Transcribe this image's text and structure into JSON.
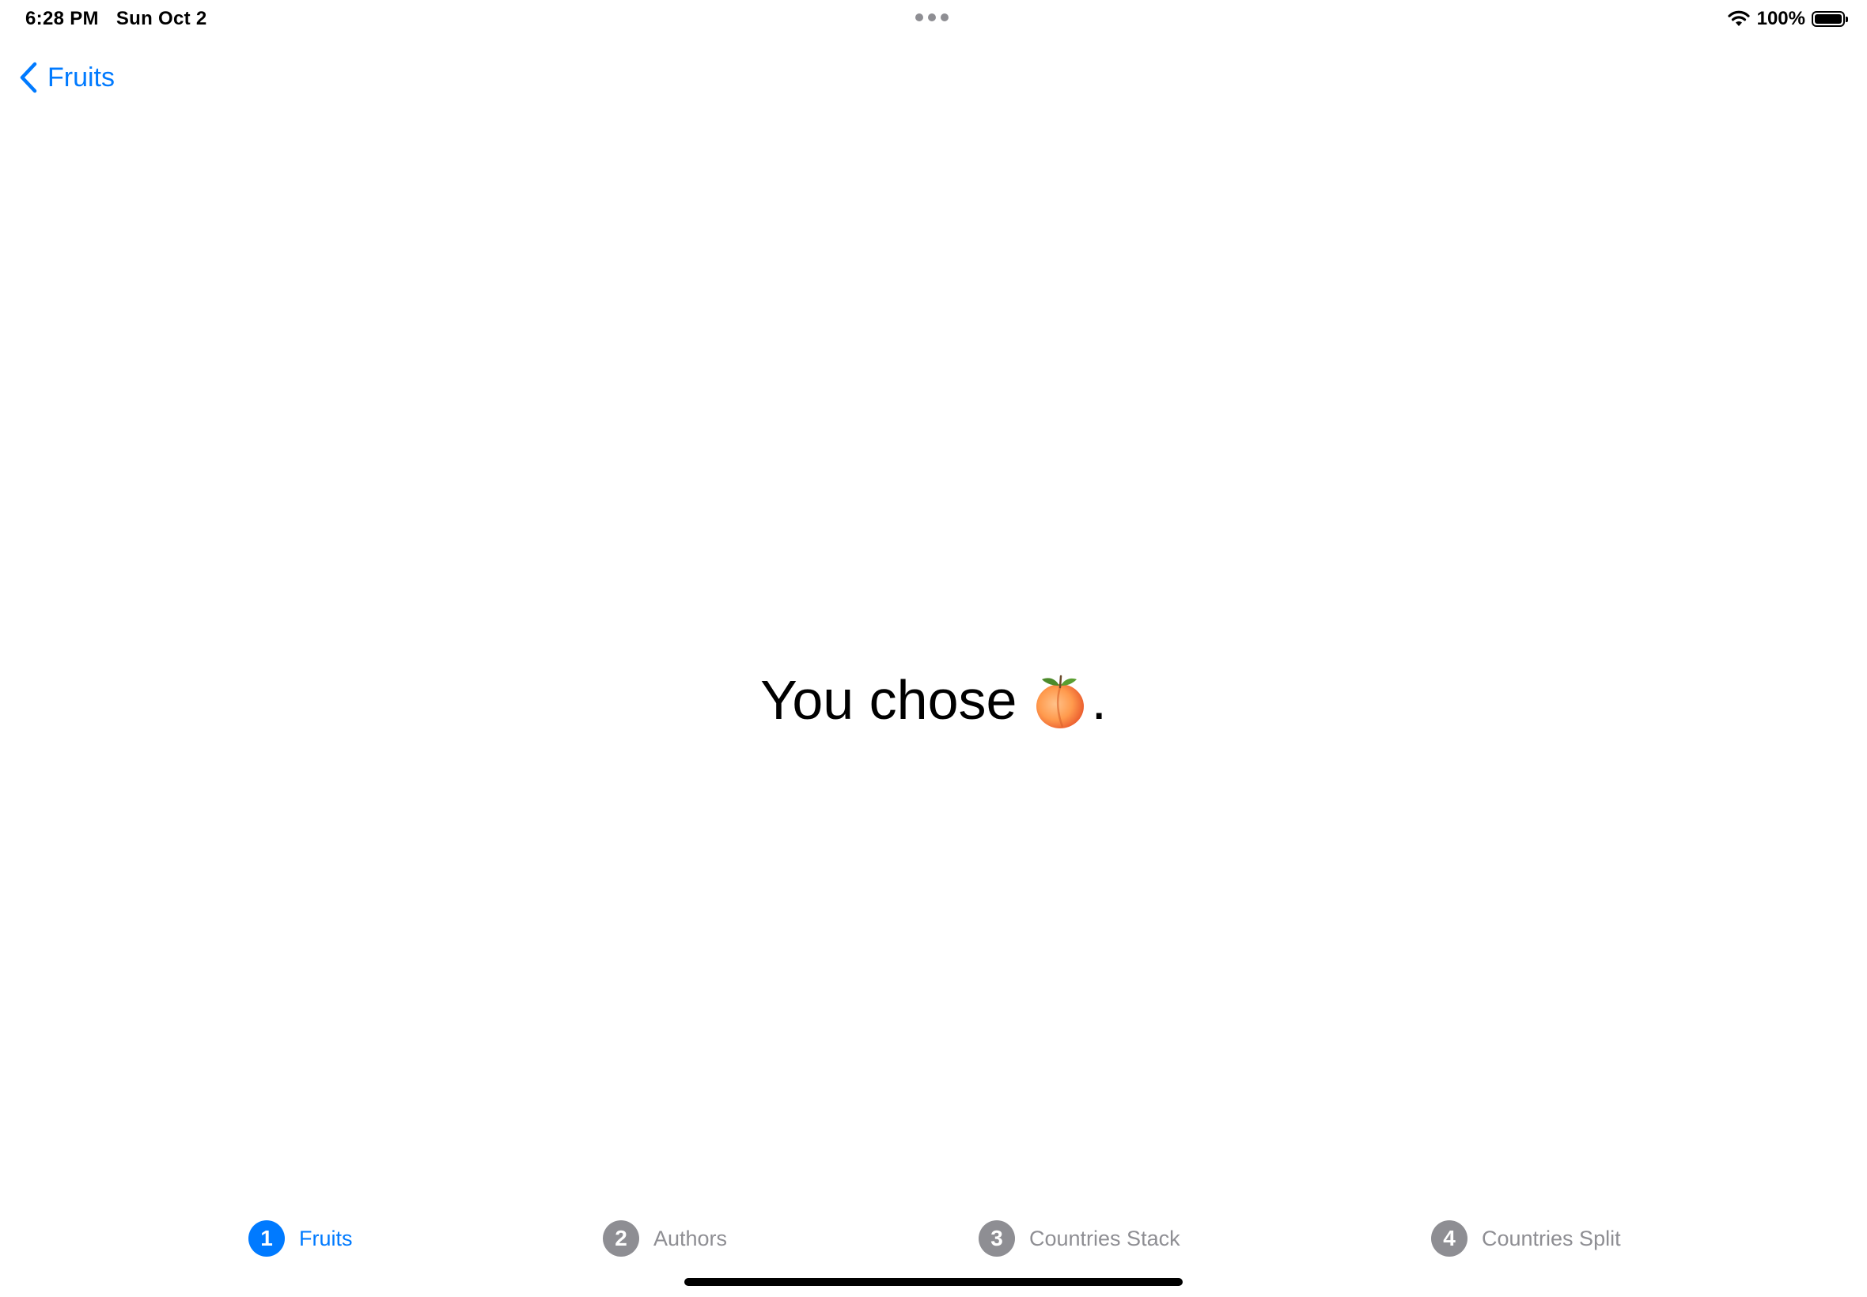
{
  "status_bar": {
    "time": "6:28 PM",
    "date": "Sun Oct 2",
    "battery_percent": "100%",
    "battery_level": 1.0,
    "icons": [
      "wifi-icon",
      "battery-icon",
      "multitask-dots-icon"
    ]
  },
  "nav": {
    "back_label": "Fruits",
    "back_icon": "chevron-left-icon"
  },
  "main": {
    "message_prefix": "You chose",
    "message_suffix": ".",
    "fruit_icon": "peach-emoji"
  },
  "tabs": [
    {
      "number": "1",
      "label": "Fruits",
      "active": true
    },
    {
      "number": "2",
      "label": "Authors",
      "active": false
    },
    {
      "number": "3",
      "label": "Countries Stack",
      "active": false
    },
    {
      "number": "4",
      "label": "Countries Split",
      "active": false
    }
  ],
  "colors": {
    "accent": "#007aff",
    "inactive": "#8e8e93",
    "text": "#000000",
    "background": "#ffffff"
  }
}
